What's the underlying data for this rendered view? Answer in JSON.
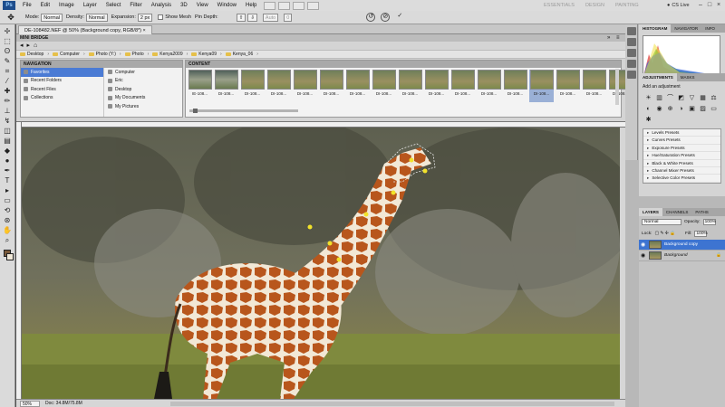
{
  "menubar": {
    "logo": "Ps",
    "items": [
      "File",
      "Edit",
      "Image",
      "Layer",
      "Select",
      "Filter",
      "Analysis",
      "3D",
      "View",
      "Window",
      "Help"
    ],
    "workspaces": [
      "ESSENTIALS",
      "DESIGN",
      "PAINTING"
    ],
    "cslive": "CS Live"
  },
  "options": {
    "mode_label": "Mode:",
    "mode_value": "Normal",
    "density_label": "Density:",
    "density_value": "Normal",
    "expansion_label": "Expansion:",
    "expansion_value": "2 px",
    "show_mesh": "Show Mesh",
    "pin_depth": "Pin Depth:",
    "rotate_value": "Auto",
    "rotate_deg": "0"
  },
  "document": {
    "tab_title": "DE-108482.NEF @ 50% (Background copy, RGB/8*) ×"
  },
  "minibridge": {
    "title": "MINI BRIDGE",
    "path": [
      "Desktop",
      "Computer",
      "Photo (Y:)",
      "Photo",
      "Kenya2009",
      "Kenya09",
      "Kenya_06"
    ],
    "navigation_header": "NAVIGATION",
    "nav_left": [
      {
        "label": "Favorites",
        "selected": true
      },
      {
        "label": "Recent Folders",
        "selected": false
      },
      {
        "label": "Recent Files",
        "selected": false
      },
      {
        "label": "Collections",
        "selected": false
      }
    ],
    "nav_right": [
      "Computer",
      "Eric",
      "Desktop",
      "My Documents",
      "My Pictures"
    ],
    "content_header": "CONTENT",
    "thumbs": [
      "IE-108...",
      "DI-108...",
      "DI-108...",
      "DI-108...",
      "DI-108...",
      "DI-108...",
      "DI-108...",
      "DI-108...",
      "DI-108...",
      "DI-108...",
      "DI-108...",
      "DI-108...",
      "DI-108...",
      "DI-108...",
      "DI-108...",
      "DI-108...",
      "DI-108..."
    ]
  },
  "status": {
    "zoom": "50%",
    "doc": "Doc: 34.8M/75.8M"
  },
  "panels": {
    "histogram_tabs": [
      "HISTOGRAM",
      "NAVIGATOR",
      "INFO"
    ],
    "adjust_tabs": [
      "ADJUSTMENTS",
      "MASKS"
    ],
    "adjust_title": "Add an adjustment",
    "presets": [
      "Levels Presets",
      "Curves Presets",
      "Exposure Presets",
      "Hue/Saturation Presets",
      "Black & White Presets",
      "Channel Mixer Presets",
      "Selective Color Presets"
    ],
    "layers_tabs": [
      "LAYERS",
      "CHANNELS",
      "PATHS"
    ],
    "blend_mode": "Normal",
    "opacity_label": "Opacity:",
    "opacity_value": "100%",
    "lock_label": "Lock:",
    "fill_label": "Fill:",
    "fill_value": "100%",
    "layers": [
      {
        "name": "Background copy",
        "active": true
      },
      {
        "name": "Background",
        "active": false
      }
    ]
  },
  "icons": {
    "tool_preset": "puppet-warp-icon",
    "tools": [
      "move",
      "marquee",
      "lasso",
      "quick-select",
      "crop",
      "eyedropper",
      "heal",
      "brush",
      "stamp",
      "history-brush",
      "eraser",
      "gradient",
      "blur",
      "dodge",
      "pen",
      "type",
      "path-select",
      "shape",
      "3d-rotate",
      "3d-orbit",
      "hand",
      "zoom"
    ]
  }
}
